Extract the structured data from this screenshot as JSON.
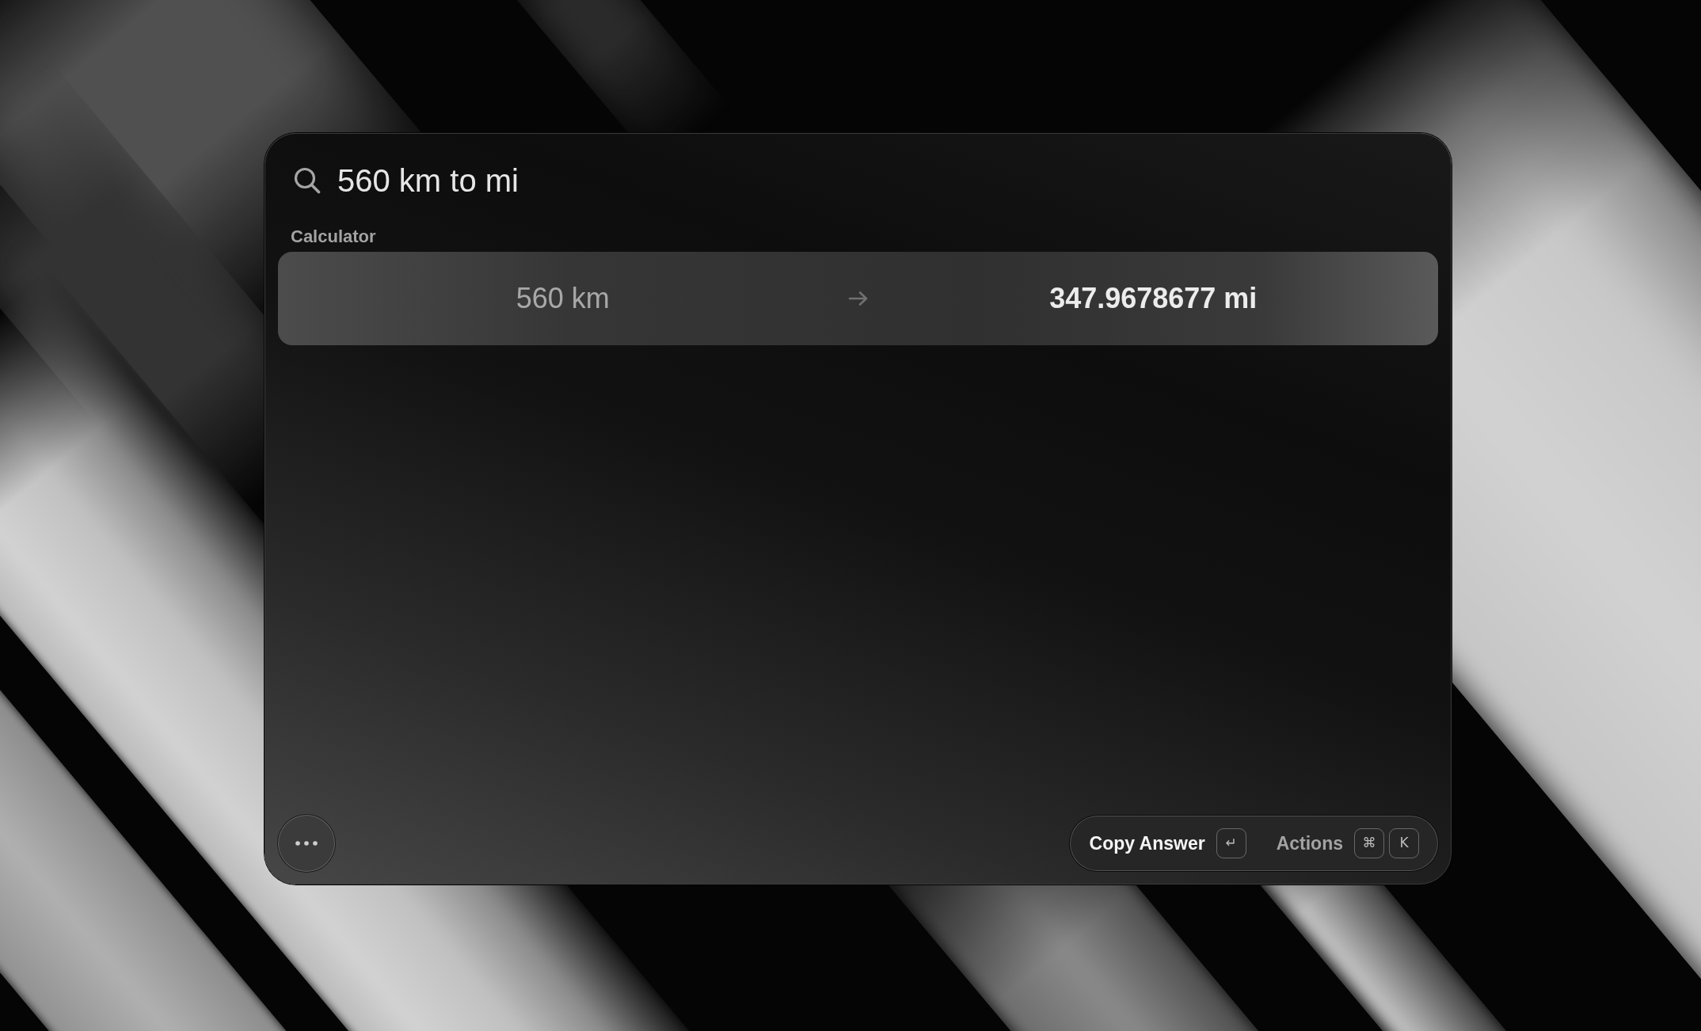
{
  "search": {
    "value": "560 km to mi"
  },
  "section": {
    "title": "Calculator"
  },
  "result": {
    "selected": true,
    "input": "560 km",
    "output": "347.9678677 mi"
  },
  "footer": {
    "actions": [
      {
        "label": "Copy Answer",
        "kind": "primary",
        "keys": [
          "↵"
        ]
      },
      {
        "label": "Actions",
        "kind": "secondary",
        "keys": [
          "⌘",
          "K"
        ]
      }
    ]
  }
}
